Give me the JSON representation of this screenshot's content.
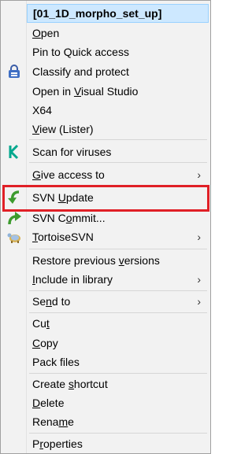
{
  "menu": {
    "title": "[01_1D_morpho_set_up]",
    "items": [
      {
        "pre": "",
        "key": "O",
        "post": "pen"
      },
      {
        "pre": "Pin to Quick access",
        "key": "",
        "post": ""
      },
      {
        "pre": "Classify and protect",
        "key": "",
        "post": ""
      },
      {
        "pre": "Open in ",
        "key": "V",
        "post": "isual Studio"
      },
      {
        "pre": "X64",
        "key": "",
        "post": ""
      },
      {
        "pre": "",
        "key": "V",
        "post": "iew (Lister)"
      },
      {
        "pre": "Scan for viruses",
        "key": "",
        "post": ""
      },
      {
        "pre": "",
        "key": "G",
        "post": "ive access to"
      },
      {
        "pre": "SVN ",
        "key": "U",
        "post": "pdate"
      },
      {
        "pre": "SVN C",
        "key": "o",
        "post": "mmit..."
      },
      {
        "pre": "",
        "key": "T",
        "post": "ortoiseSVN"
      },
      {
        "pre": "Restore previous ",
        "key": "v",
        "post": "ersions"
      },
      {
        "pre": "",
        "key": "I",
        "post": "nclude in library"
      },
      {
        "pre": "Se",
        "key": "n",
        "post": "d to"
      },
      {
        "pre": "Cu",
        "key": "t",
        "post": ""
      },
      {
        "pre": "",
        "key": "C",
        "post": "opy"
      },
      {
        "pre": "Pack files",
        "key": "",
        "post": ""
      },
      {
        "pre": "Create ",
        "key": "s",
        "post": "hortcut"
      },
      {
        "pre": "",
        "key": "D",
        "post": "elete"
      },
      {
        "pre": "Rena",
        "key": "m",
        "post": "e"
      },
      {
        "pre": "P",
        "key": "r",
        "post": "operties"
      }
    ],
    "submenu_arrow": "›",
    "icons": {
      "classify": "lock-shield-icon",
      "scan": "kaspersky-k-icon",
      "svn_update": "svn-update-arrow-icon",
      "svn_commit": "svn-commit-arrow-icon",
      "tortoise": "tortoisesvn-icon"
    },
    "colors": {
      "highlight_border": "#e01f26",
      "title_bg": "#cde8ff",
      "title_border": "#99d1ff",
      "menu_bg": "#f2f2f2"
    }
  }
}
